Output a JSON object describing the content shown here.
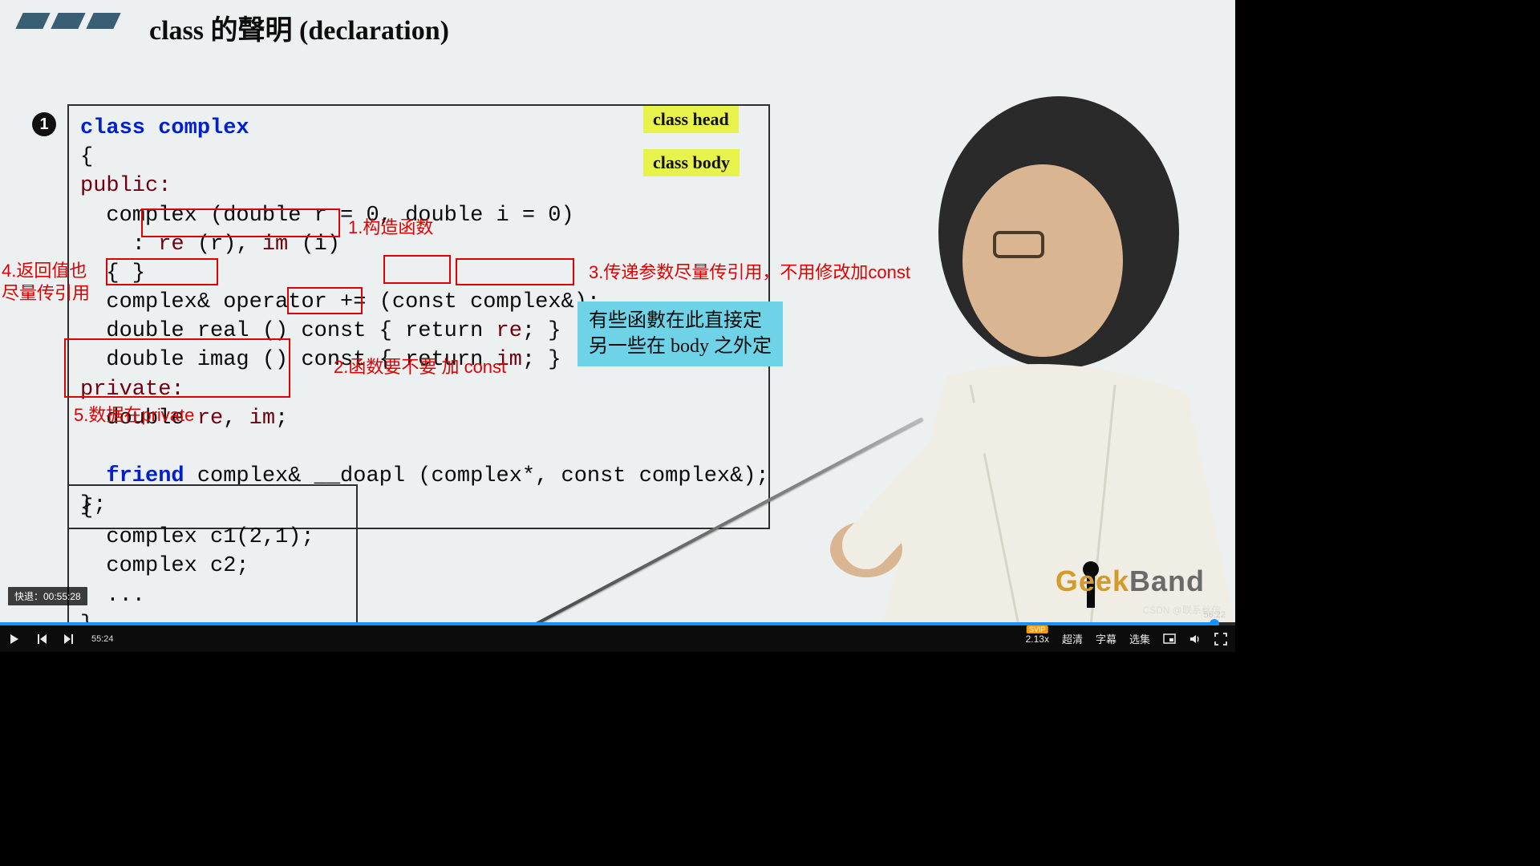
{
  "slide": {
    "title": "class 的聲明 (declaration)",
    "marker_number": "1",
    "tag_class_head": "class head",
    "tag_class_body": "class body",
    "cyan_note_line1": "有些函數在此直接定",
    "cyan_note_line2": "另一些在 body 之外定",
    "watermark_csdn": "CSDN @联系丝信",
    "geek": "Geek",
    "band": "Band"
  },
  "code": {
    "l1_kw": "class",
    "l1_name": " complex",
    "l2": "{",
    "l3_kw": "public:",
    "l4": "  complex (double r = 0, double i = 0)",
    "l5a": "    : ",
    "l5_re": "re",
    "l5b": " (r), ",
    "l5_im": "im",
    "l5c": " (i)",
    "l6": "  { }",
    "l7a": "  ",
    "l7_ret": "complex&",
    "l7b": " operator += (",
    "l7_const": "const",
    "l7c": " ",
    "l7_arg": "complex&",
    "l7d": ");",
    "l8a": "  double real () ",
    "l8_const": "const",
    "l8b": " { return ",
    "l8_re": "re",
    "l8c": "; }",
    "l9a": "  double imag () const { return ",
    "l9_im": "im",
    "l9b": "; }",
    "l10_kw": "private:",
    "l11a": "  double ",
    "l11_re": "re",
    "l11b": ", ",
    "l11_im": "im",
    "l11c": ";",
    "l12": "",
    "l13a": "  ",
    "l13_kw": "friend",
    "l13b": " complex& __doapl (complex*, const complex&);",
    "l14": "};"
  },
  "usage": {
    "u1": "{",
    "u2": "  complex c1(2,1);",
    "u3": "  complex c2;",
    "u4": "  ...",
    "u5": "}"
  },
  "annotations": {
    "a1": "1.构造函数",
    "a2": "2.函数要不要 加 const",
    "a3": "3.传递参数尽量传引用，不用修改加const",
    "a4_l1": "4.返回值也",
    "a4_l2": "尽量传引用",
    "a5": "5.数据在private"
  },
  "player": {
    "seek_tooltip": "快退：00:55:28",
    "current_time": "55:24",
    "total_time": "56:22",
    "progress_percent": 98.3,
    "speed": "2.13x",
    "speed_badge": "SVIP",
    "quality": "超清",
    "subtitle": "字幕",
    "playlist": "选集"
  }
}
